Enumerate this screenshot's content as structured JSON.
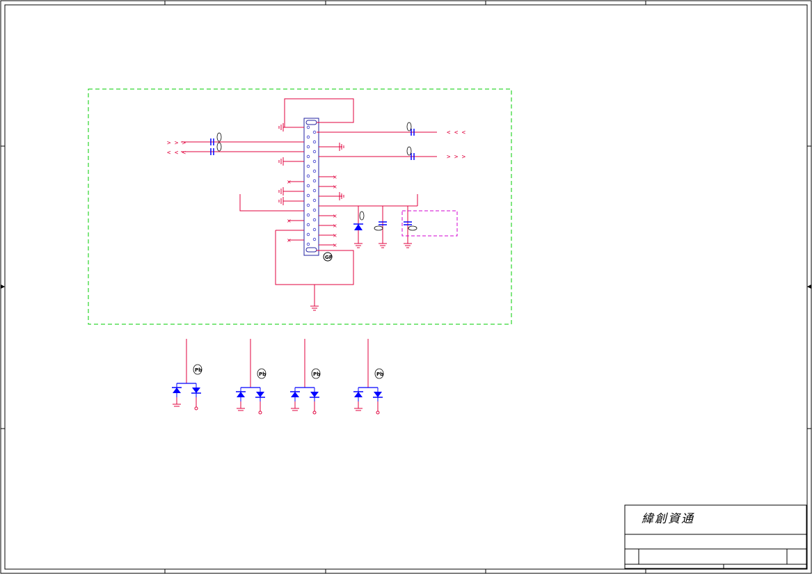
{
  "title_block": {
    "company_name": "緯創資通"
  },
  "markers": {
    "pb_label": "Pb",
    "gp_label": "GP"
  },
  "signal_arrows": {
    "in_left": "> > >",
    "out_left": "< < <",
    "out_right": "< < <",
    "in_right": "> > >"
  },
  "colors": {
    "wire": "#e0003c",
    "component": "#0000ff",
    "pin_circle": "#3333cc",
    "frame": "#000000",
    "block_border": "#00cc00",
    "optional_border": "#d000d0"
  }
}
